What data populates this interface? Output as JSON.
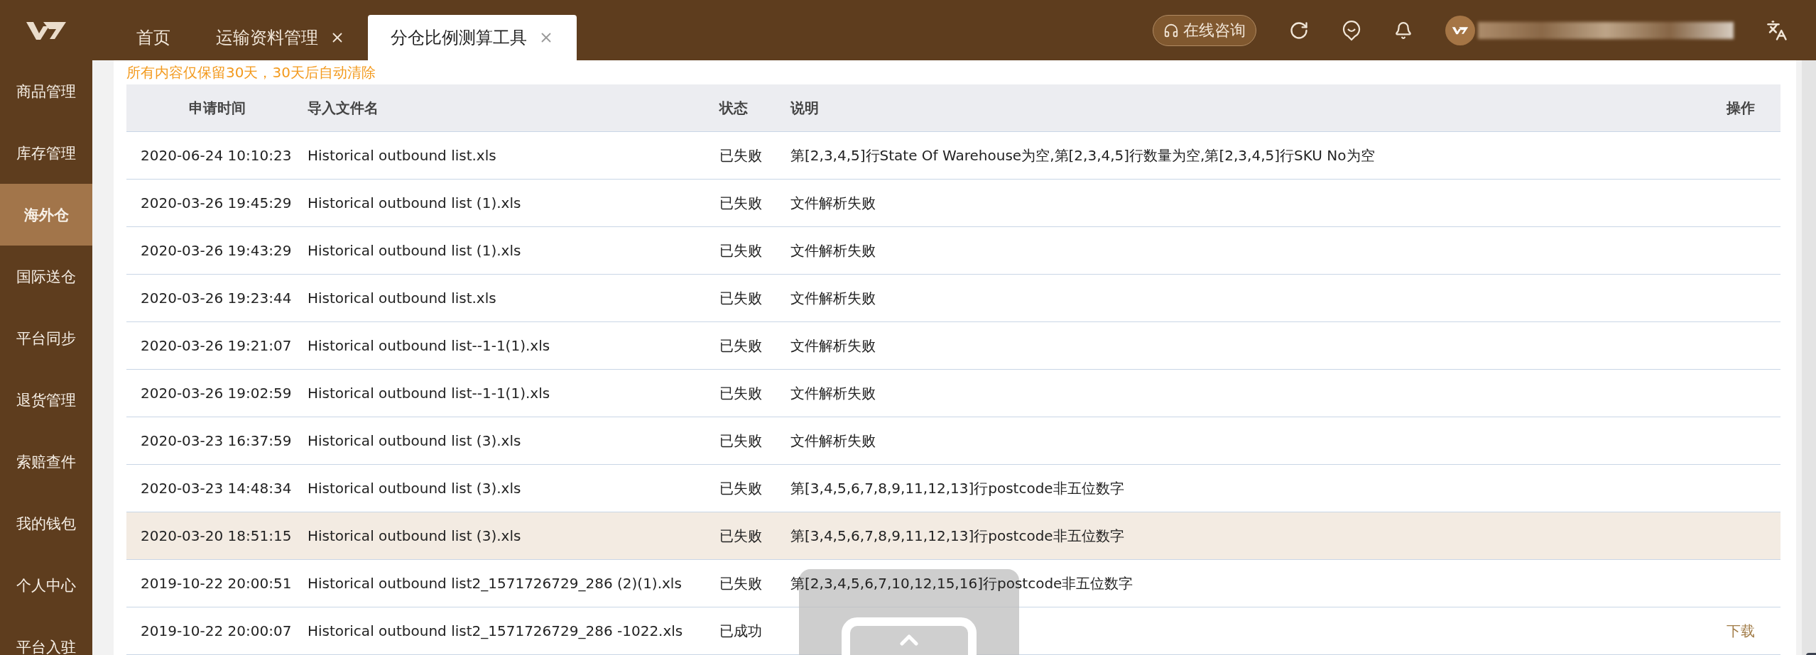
{
  "tabs": [
    {
      "label": "首页",
      "closable": false,
      "selected": false
    },
    {
      "label": "运输资料管理",
      "closable": true,
      "selected": false
    },
    {
      "label": "分仓比例测算工具",
      "closable": true,
      "selected": true
    }
  ],
  "header": {
    "consult_button": "在线咨询"
  },
  "sidebar": {
    "items": [
      {
        "label": "商品管理",
        "selected": false
      },
      {
        "label": "库存管理",
        "selected": false
      },
      {
        "label": "海外仓",
        "selected": true
      },
      {
        "label": "国际送仓",
        "selected": false
      },
      {
        "label": "平台同步",
        "selected": false
      },
      {
        "label": "退货管理",
        "selected": false
      },
      {
        "label": "索赔查件",
        "selected": false
      },
      {
        "label": "我的钱包",
        "selected": false
      },
      {
        "label": "个人中心",
        "selected": false
      },
      {
        "label": "平台入驻",
        "selected": false
      }
    ]
  },
  "notice": "所有内容仅保留30天，30天后自动清除",
  "table": {
    "columns": [
      "申请时间",
      "导入文件名",
      "状态",
      "说明",
      "操作"
    ],
    "rows": [
      {
        "time": "2020-06-24 10:10:23",
        "file": "Historical outbound list.xls",
        "status": "已失败",
        "note": "第[2,3,4,5]行State Of Warehouse为空,第[2,3,4,5]行数量为空,第[2,3,4,5]行SKU No为空",
        "highlighted": false
      },
      {
        "time": "2020-03-26 19:45:29",
        "file": "Historical outbound list (1).xls",
        "status": "已失败",
        "note": "文件解析失败",
        "highlighted": false
      },
      {
        "time": "2020-03-26 19:43:29",
        "file": "Historical outbound list (1).xls",
        "status": "已失败",
        "note": "文件解析失败",
        "highlighted": false
      },
      {
        "time": "2020-03-26 19:23:44",
        "file": "Historical outbound list.xls",
        "status": "已失败",
        "note": "文件解析失败",
        "highlighted": false
      },
      {
        "time": "2020-03-26 19:21:07",
        "file": "Historical outbound list--1-1(1).xls",
        "status": "已失败",
        "note": "文件解析失败",
        "highlighted": false
      },
      {
        "time": "2020-03-26 19:02:59",
        "file": "Historical outbound list--1-1(1).xls",
        "status": "已失败",
        "note": "文件解析失败",
        "highlighted": false
      },
      {
        "time": "2020-03-23 16:37:59",
        "file": "Historical outbound list (3).xls",
        "status": "已失败",
        "note": "文件解析失败",
        "highlighted": false
      },
      {
        "time": "2020-03-23 14:48:34",
        "file": "Historical outbound list (3).xls",
        "status": "已失败",
        "note": "第[3,4,5,6,7,8,9,11,12,13]行postcode非五位数字",
        "highlighted": false
      },
      {
        "time": "2020-03-20 18:51:15",
        "file": "Historical outbound list (3).xls",
        "status": "已失败",
        "note": "第[3,4,5,6,7,8,9,11,12,13]行postcode非五位数字",
        "highlighted": true
      },
      {
        "time": "2019-10-22 20:00:51",
        "file": "Historical outbound list2_1571726729_286 (2)(1).xls",
        "status": "已失败",
        "note": "第[2,3,4,5,6,7,10,12,15,16]行postcode非五位数字",
        "highlighted": false
      },
      {
        "time": "2019-10-22 20:00:07",
        "file": "Historical outbound list2_1571726729_286 -1022.xls",
        "status": "已成功",
        "action": "下载",
        "highlighted": false
      }
    ]
  }
}
